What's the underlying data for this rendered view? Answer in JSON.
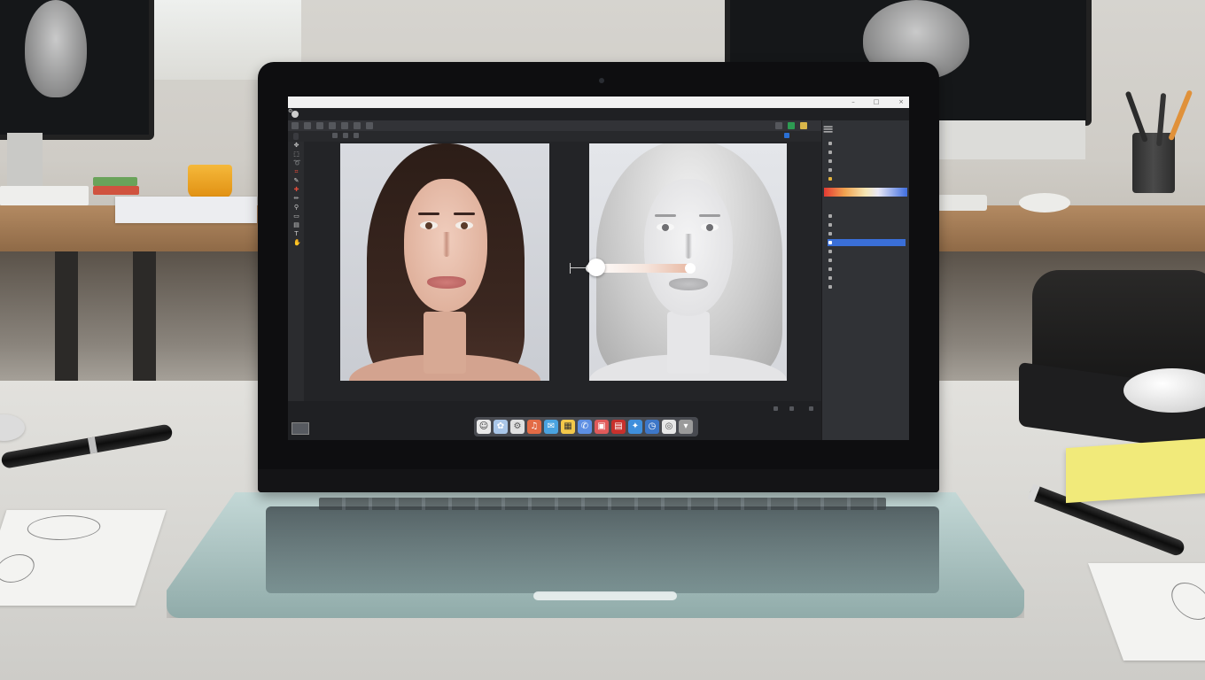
{
  "scene": {
    "description_tags": [
      "laptop",
      "photo-editing-app",
      "office-desk"
    ],
    "accent_colors": {
      "selection": "#3a6fd8",
      "wood": "#a27a54",
      "sticky_note": "#f1ea7a"
    }
  },
  "app": {
    "window_title": "",
    "menu_items": [
      "",
      "",
      "",
      "",
      "",
      "",
      "",
      "",
      "",
      "",
      "",
      "",
      "",
      ""
    ],
    "tabs": [
      ""
    ],
    "documents": [
      {
        "name": "portrait-photo",
        "style": "color"
      },
      {
        "name": "portrait-sketch",
        "style": "grayscale"
      }
    ],
    "slider": {
      "level": 0.15
    },
    "panel": {
      "header": "",
      "adjustments": [
        "",
        "",
        "",
        "",
        ""
      ],
      "layers_header": "",
      "layers": [
        "",
        "",
        "",
        "",
        "",
        "",
        "",
        "",
        ""
      ],
      "selected_layer_index": 3
    },
    "timeline_labels": [
      ""
    ],
    "dock_icons": [
      "finder-icon",
      "photos-icon",
      "settings-icon",
      "music-icon",
      "notes-icon",
      "gallery-icon",
      "mail-icon",
      "pdf-icon",
      "books-icon",
      "safari-icon",
      "clock-icon",
      "trash-icon"
    ]
  }
}
